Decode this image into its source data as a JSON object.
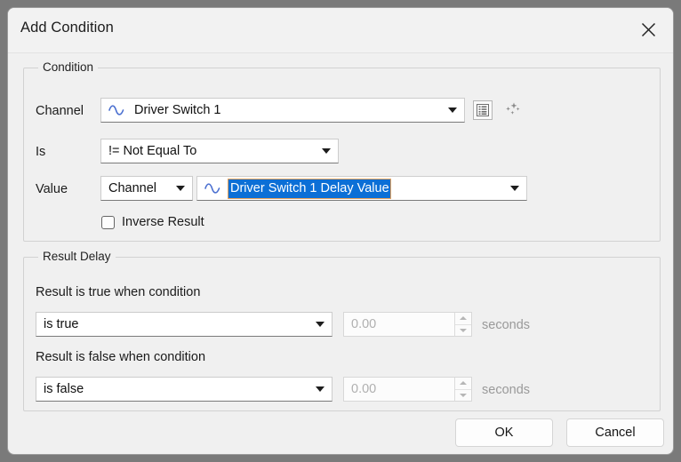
{
  "window": {
    "title": "Add Condition",
    "close_icon": "close-icon"
  },
  "condition_group": {
    "legend": "Condition",
    "channel": {
      "label": "Channel",
      "icon": "waveform-icon",
      "value": "Driver Switch 1",
      "browse_icon": "list-icon",
      "magic_icon": "sparkles-icon"
    },
    "is": {
      "label": "Is",
      "value": "!= Not Equal To"
    },
    "value": {
      "label": "Value",
      "source_type": "Channel",
      "icon": "waveform-icon",
      "selected_text": "Driver Switch 1 Delay Value"
    },
    "inverse": {
      "label": "Inverse Result",
      "checked": false
    }
  },
  "result_delay_group": {
    "legend": "Result Delay",
    "true_row": {
      "label": "Result is true when condition",
      "condition": "is true",
      "delay": "0.00",
      "units": "seconds"
    },
    "false_row": {
      "label": "Result is false when condition",
      "condition": "is false",
      "delay": "0.00",
      "units": "seconds"
    }
  },
  "footer": {
    "ok_label": "OK",
    "cancel_label": "Cancel"
  },
  "colors": {
    "selection_blue": "#0c6fd6",
    "focus_orange": "#e8a25c",
    "waveform_blue": "#4a6fd0",
    "dialog_bg": "#f0f0f0"
  }
}
